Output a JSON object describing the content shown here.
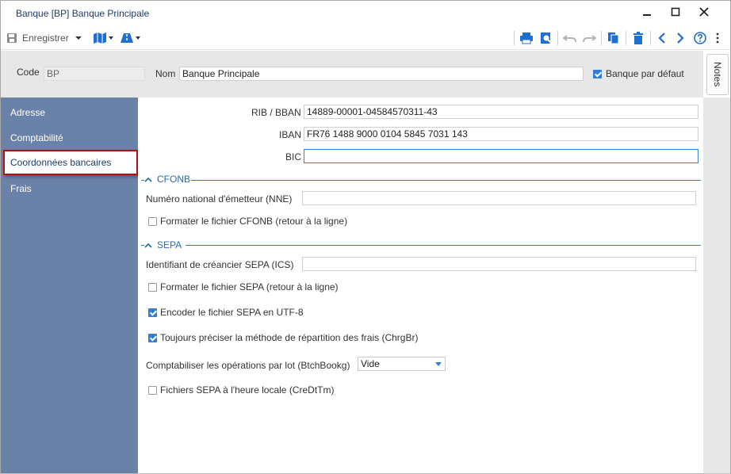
{
  "window": {
    "title": "Banque [BP] Banque Principale"
  },
  "toolbar": {
    "save_label": "Enregistrer"
  },
  "header": {
    "code_label": "Code",
    "code_value": "BP",
    "nom_label": "Nom",
    "nom_value": "Banque Principale",
    "default_label": "Banque par défaut",
    "default_checked": true
  },
  "notes_tab": "Notes",
  "sidebar": {
    "items": [
      {
        "label": "Adresse",
        "active": false
      },
      {
        "label": "Comptabilité",
        "active": false
      },
      {
        "label": "Coordonnées bancaires",
        "active": true
      },
      {
        "label": "Frais",
        "active": false
      }
    ]
  },
  "bank": {
    "rib_label": "RIB / BBAN",
    "rib_value": "14889-00001-04584570311-43",
    "iban_label": "IBAN",
    "iban_value": "FR76 1488 9000 0104 5845 7031 143",
    "bic_label": "BIC",
    "bic_value": ""
  },
  "cfonb": {
    "title": "CFONB",
    "nne_label": "Numéro national d'émetteur (NNE)",
    "nne_value": "",
    "format_label": "Formater le fichier CFONB (retour à la ligne)",
    "format_checked": false
  },
  "sepa": {
    "title": "SEPA",
    "ics_label": "Identifiant de créancier SEPA (ICS)",
    "ics_value": "",
    "format_label": "Formater le fichier SEPA (retour à la ligne)",
    "format_checked": false,
    "utf8_label": "Encoder le fichier SEPA en UTF-8",
    "utf8_checked": true,
    "chrgbr_label": "Toujours préciser la méthode de répartition des frais (ChrgBr)",
    "chrgbr_checked": true,
    "batch_label": "Comptabiliser les opérations par lot (BtchBookg)",
    "batch_value": "Vide",
    "local_time_label": "Fichiers SEPA à l'heure locale (CreDtTm)",
    "local_time_checked": false
  },
  "colors": {
    "sidebar": "#6b82a8",
    "accent": "#2f7dd4",
    "section": "#2a6db0",
    "active_border": "#b30f0f"
  }
}
